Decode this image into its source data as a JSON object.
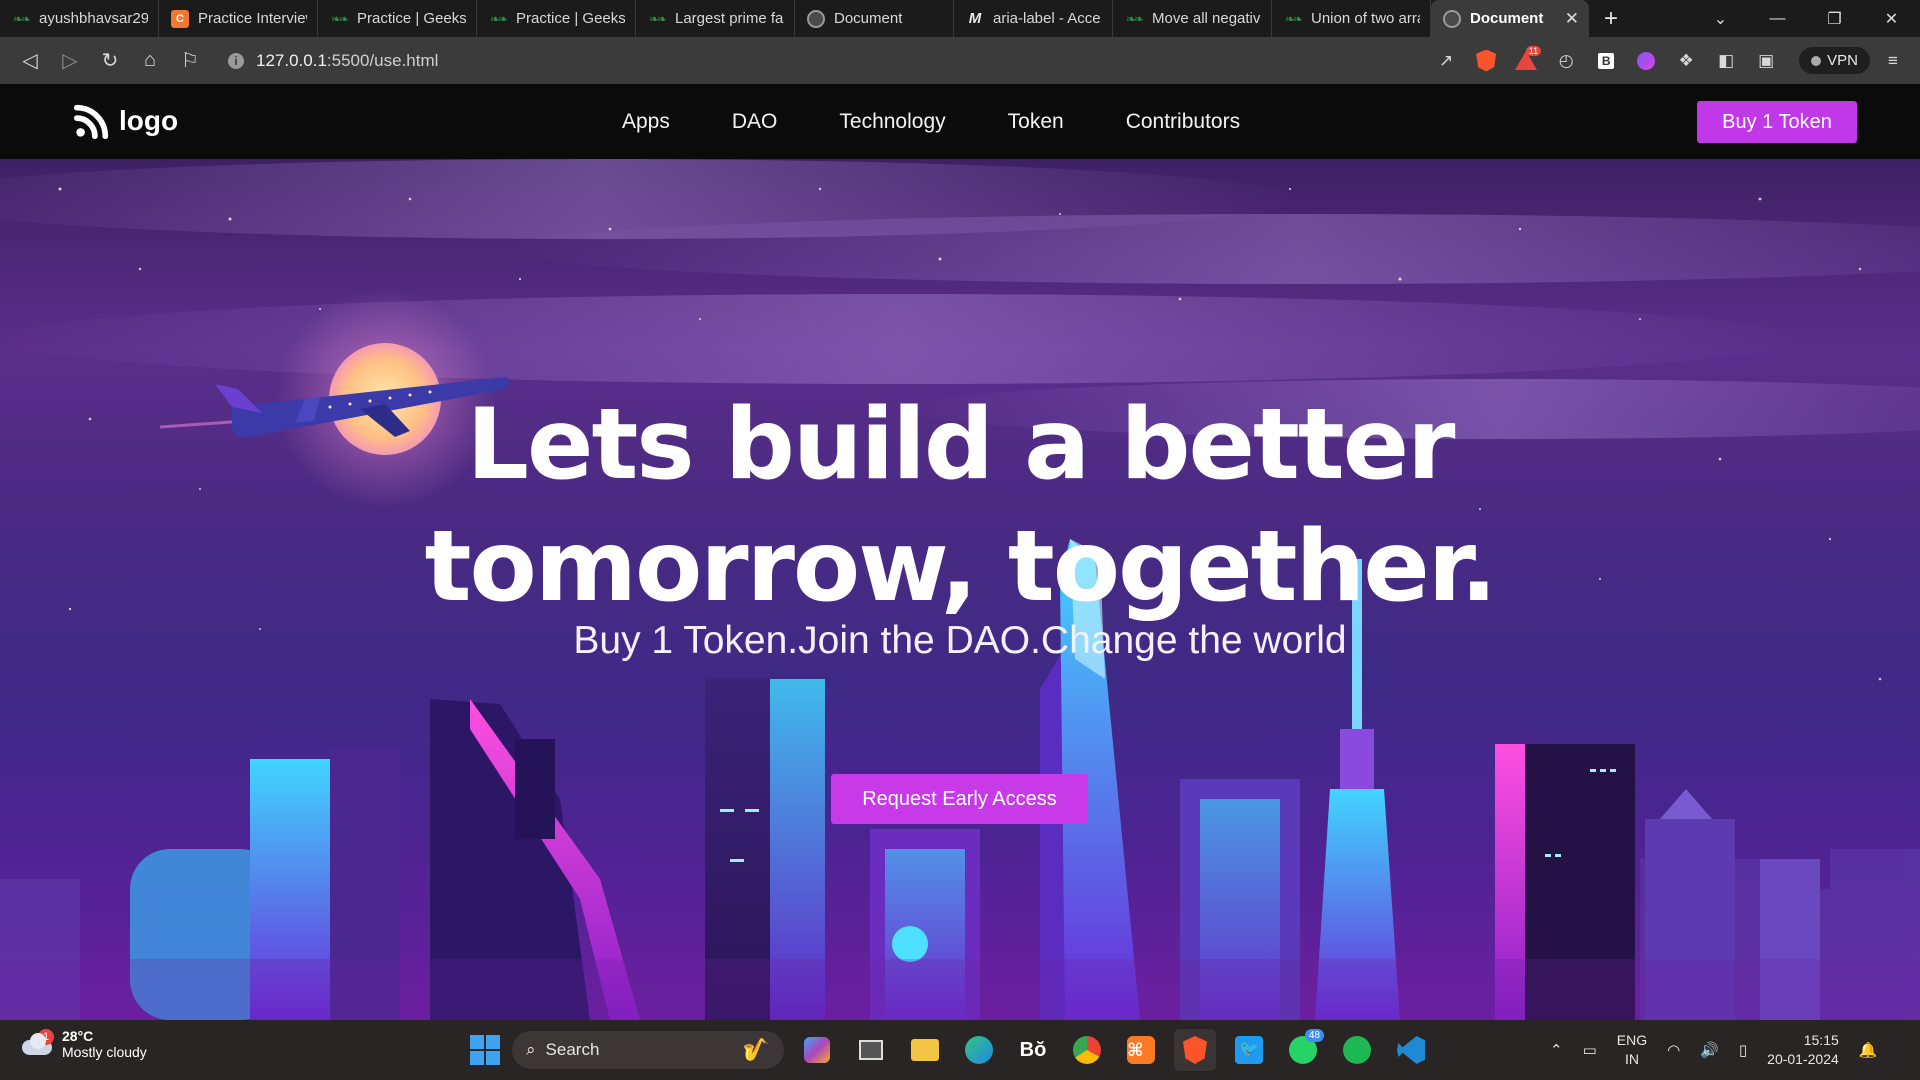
{
  "browser": {
    "tabs": [
      {
        "title": "ayushbhavsar29",
        "favicon": "gfg-icon"
      },
      {
        "title": "Practice Interview",
        "favicon": "codechef-icon"
      },
      {
        "title": "Practice | Geeksfo",
        "favicon": "gfg-icon"
      },
      {
        "title": "Practice | Geeksfo",
        "favicon": "gfg-icon"
      },
      {
        "title": "Largest prime fac",
        "favicon": "gfg-icon"
      },
      {
        "title": "Document",
        "favicon": "globe-icon"
      },
      {
        "title": "aria-label - Acce",
        "favicon": "mdn-icon"
      },
      {
        "title": "Move all negativ",
        "favicon": "gfg-icon"
      },
      {
        "title": "Union of two arra",
        "favicon": "gfg-icon"
      },
      {
        "title": "Document",
        "favicon": "globe-icon",
        "active": true
      }
    ],
    "url_host": "127.0.0.1",
    "url_rest": ":5500/use.html",
    "vpn_label": "VPN",
    "brave_badge": "11"
  },
  "site": {
    "logo_text": "logo",
    "nav": [
      "Apps",
      "DAO",
      "Technology",
      "Token",
      "Contributors"
    ],
    "buy_button": "Buy 1 Token",
    "hero_title_line1": "Lets build a better",
    "hero_title_line2": "tomorrow, together.",
    "hero_subtitle": "Buy 1 Token.Join the DAO.Change the world",
    "cta_button": "Request Early Access",
    "colors": {
      "accent": "#c138e8",
      "nav_bg": "#0b0b0b",
      "text": "#ffffff"
    }
  },
  "taskbar": {
    "weather_temp": "28°C",
    "weather_desc": "Mostly cloudy",
    "weather_badge": "1",
    "search_label": "Search",
    "whatsapp_badge": "48",
    "lang_line1": "ENG",
    "lang_line2": "IN",
    "time": "15:15",
    "date": "20-01-2024"
  }
}
